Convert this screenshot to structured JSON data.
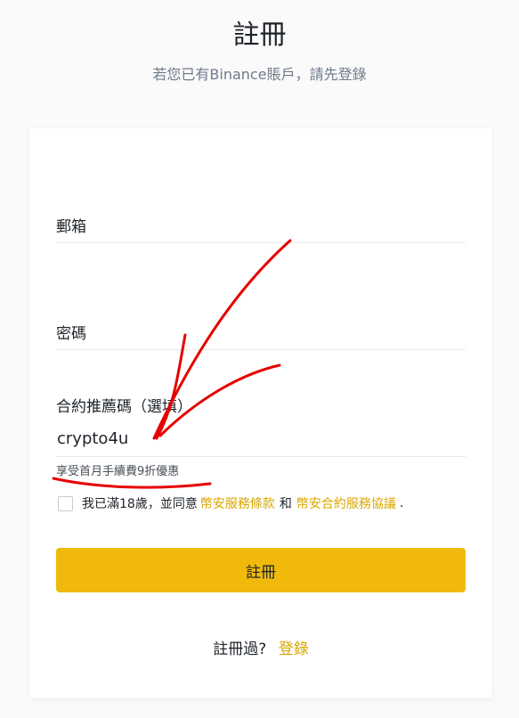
{
  "header": {
    "title": "註冊",
    "subtitle": "若您已有Binance賬戶，請先登錄"
  },
  "form": {
    "email_label": "郵箱",
    "password_label": "密碼",
    "referral_label": "合約推薦碼（選填）",
    "referral_value": "crypto4u",
    "promo_text": "享受首月手續費9折優惠",
    "consent_prefix": "我已滿18歲，並同意",
    "terms_link": "幣安服務條款",
    "consent_and": "和",
    "futures_terms_link": "幣安合約服務協議",
    "consent_suffix": ".",
    "submit_label": "註冊"
  },
  "footer": {
    "registered_text": "註冊過?",
    "login_link": "登錄"
  },
  "colors": {
    "accent": "#f0b90b",
    "link": "#d9a600",
    "annotation": "#e60000"
  }
}
